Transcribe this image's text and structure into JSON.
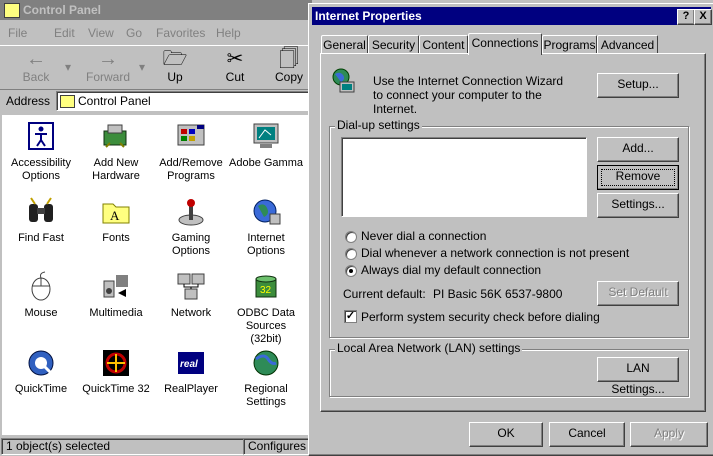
{
  "control_panel": {
    "title": "Control Panel",
    "menu": [
      "File",
      "Edit",
      "View",
      "Go",
      "Favorites",
      "Help"
    ],
    "toolbar": {
      "back": "Back",
      "forward": "Forward",
      "up": "Up",
      "cut": "Cut",
      "copy": "Copy"
    },
    "address_label": "Address",
    "address_value": "Control Panel",
    "items": [
      {
        "label": "Accessibility Options",
        "icon": "accessibility-icon"
      },
      {
        "label": "Add New Hardware",
        "icon": "hardware-icon"
      },
      {
        "label": "Add/Remove Programs",
        "icon": "programs-icon"
      },
      {
        "label": "Adobe Gamma",
        "icon": "monitor-icon"
      },
      {
        "label": "Find Fast",
        "icon": "binoculars-icon"
      },
      {
        "label": "Fonts",
        "icon": "fonts-folder-icon"
      },
      {
        "label": "Gaming Options",
        "icon": "joystick-icon"
      },
      {
        "label": "Internet Options",
        "icon": "globe-icon"
      },
      {
        "label": "Mouse",
        "icon": "mouse-icon"
      },
      {
        "label": "Multimedia",
        "icon": "multimedia-icon"
      },
      {
        "label": "Network",
        "icon": "network-icon"
      },
      {
        "label": "ODBC Data Sources (32bit)",
        "icon": "odbc-icon"
      },
      {
        "label": "QuickTime",
        "icon": "quicktime-icon"
      },
      {
        "label": "QuickTime 32",
        "icon": "quicktime32-icon"
      },
      {
        "label": "RealPlayer",
        "icon": "realplayer-icon"
      },
      {
        "label": "Regional Settings",
        "icon": "regional-globe-icon"
      }
    ],
    "status_left": "1 object(s) selected",
    "status_right": "Configures yo"
  },
  "dialog": {
    "title": "Internet Properties",
    "tabs": [
      "General",
      "Security",
      "Content",
      "Connections",
      "Programs",
      "Advanced"
    ],
    "active_tab": "Connections",
    "wizard_text": "Use the Internet Connection Wizard to connect your computer to the Internet.",
    "setup_button": "Setup...",
    "dialup_group": "Dial-up settings",
    "add_button": "Add...",
    "remove_button": "Remove",
    "settings_button": "Settings...",
    "radio_never": "Never dial a connection",
    "radio_whenever": "Dial whenever a network connection is not present",
    "radio_always": "Always dial my default connection",
    "selected_radio": "always",
    "current_default_label": "Current default:",
    "current_default_value": "PI Basic 56K 6537-9800",
    "set_default_button": "Set Default",
    "security_check_label": "Perform system security check before dialing",
    "security_check_checked": true,
    "lan_group": "Local Area Network (LAN) settings",
    "lan_button": "LAN Settings...",
    "ok_button": "OK",
    "cancel_button": "Cancel",
    "apply_button": "Apply",
    "help_button": "?",
    "close_button": "X"
  },
  "colors": {
    "title_active": "#000080",
    "title_inactive": "#808080",
    "face": "#c0c0c0"
  }
}
